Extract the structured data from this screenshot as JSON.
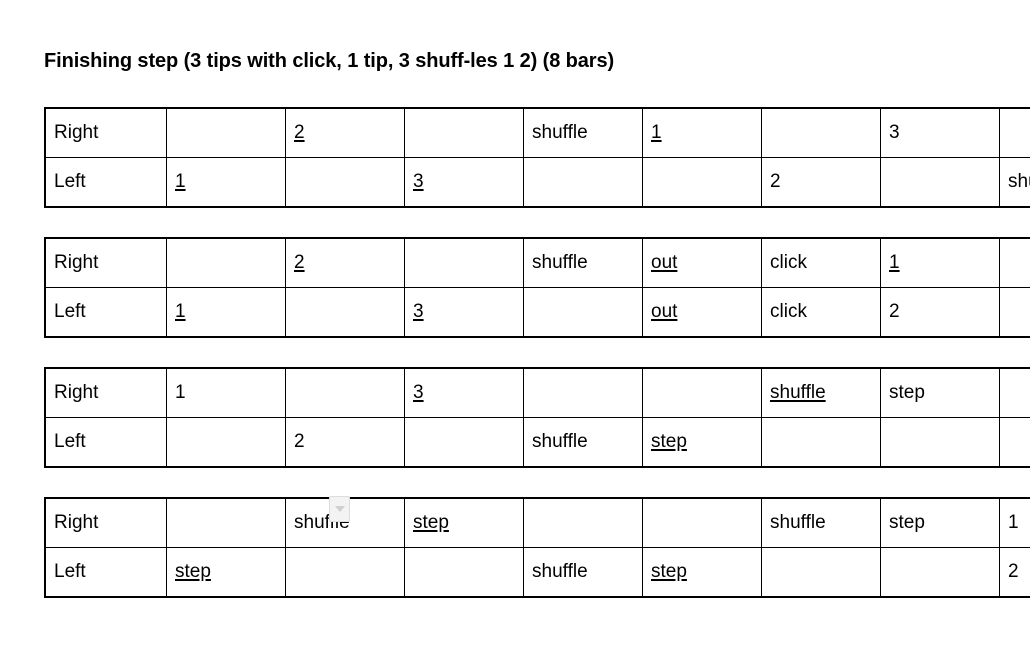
{
  "title": "Finishing step (3 tips with click, 1 tip, 3 shuff-les 1 2) (8 bars)",
  "widgets": {
    "dropdown_caret_icon": "chevron-down-icon"
  },
  "tables": [
    {
      "name": "bars-table-1",
      "rows": [
        {
          "label": "Right",
          "cells": [
            {
              "text": "",
              "underline": false,
              "align": "left"
            },
            {
              "text": "2",
              "underline": true,
              "align": "left"
            },
            {
              "text": "",
              "underline": false,
              "align": "left"
            },
            {
              "text": "shuffle",
              "underline": false,
              "align": "left"
            },
            {
              "text": "1",
              "underline": true,
              "align": "left"
            },
            {
              "text": "",
              "underline": false,
              "align": "left"
            },
            {
              "text": "3",
              "underline": false,
              "align": "left"
            },
            {
              "text": "",
              "underline": false,
              "align": "left"
            }
          ]
        },
        {
          "label": "Left",
          "cells": [
            {
              "text": "1",
              "underline": true,
              "align": "left"
            },
            {
              "text": "",
              "underline": false,
              "align": "left"
            },
            {
              "text": "3",
              "underline": true,
              "align": "left"
            },
            {
              "text": "",
              "underline": false,
              "align": "left"
            },
            {
              "text": "",
              "underline": false,
              "align": "left"
            },
            {
              "text": "2",
              "underline": false,
              "align": "left"
            },
            {
              "text": "",
              "underline": false,
              "align": "left"
            },
            {
              "text": "shuffle",
              "underline": false,
              "align": "left"
            }
          ]
        }
      ]
    },
    {
      "name": "bars-table-2",
      "rows": [
        {
          "label": "Right",
          "cells": [
            {
              "text": "",
              "underline": false,
              "align": "left"
            },
            {
              "text": "2",
              "underline": true,
              "align": "left"
            },
            {
              "text": "",
              "underline": false,
              "align": "left"
            },
            {
              "text": "shuffle",
              "underline": false,
              "align": "left"
            },
            {
              "text": "out",
              "underline": true,
              "align": "left"
            },
            {
              "text": "click",
              "underline": false,
              "align": "left"
            },
            {
              "text": "1",
              "underline": true,
              "align": "left"
            },
            {
              "text": "",
              "underline": false,
              "align": "left"
            }
          ]
        },
        {
          "label": "Left",
          "cells": [
            {
              "text": "1",
              "underline": true,
              "align": "left"
            },
            {
              "text": "",
              "underline": false,
              "align": "left"
            },
            {
              "text": "3",
              "underline": true,
              "align": "left"
            },
            {
              "text": "",
              "underline": false,
              "align": "left"
            },
            {
              "text": "out",
              "underline": true,
              "align": "left"
            },
            {
              "text": "click",
              "underline": false,
              "align": "left"
            },
            {
              "text": "2",
              "underline": false,
              "align": "right"
            },
            {
              "text": "",
              "underline": false,
              "align": "left"
            }
          ]
        }
      ]
    },
    {
      "name": "bars-table-3",
      "rows": [
        {
          "label": "Right",
          "cells": [
            {
              "text": "1",
              "underline": false,
              "align": "left"
            },
            {
              "text": "",
              "underline": false,
              "align": "left"
            },
            {
              "text": "3",
              "underline": true,
              "align": "left"
            },
            {
              "text": "",
              "underline": false,
              "align": "left"
            },
            {
              "text": "",
              "underline": false,
              "align": "left"
            },
            {
              "text": "shuffle",
              "underline": true,
              "align": "left"
            },
            {
              "text": "step",
              "underline": false,
              "align": "left"
            },
            {
              "text": "",
              "underline": false,
              "align": "left"
            }
          ]
        },
        {
          "label": "Left",
          "cells": [
            {
              "text": "",
              "underline": false,
              "align": "left"
            },
            {
              "text": "2",
              "underline": false,
              "align": "left"
            },
            {
              "text": "",
              "underline": false,
              "align": "left"
            },
            {
              "text": "shuffle",
              "underline": false,
              "align": "left"
            },
            {
              "text": "step",
              "underline": true,
              "align": "left"
            },
            {
              "text": "",
              "underline": false,
              "align": "left"
            },
            {
              "text": "",
              "underline": false,
              "align": "left"
            },
            {
              "text": "",
              "underline": false,
              "align": "left"
            }
          ]
        }
      ]
    },
    {
      "name": "bars-table-4",
      "rows": [
        {
          "label": "Right",
          "cells": [
            {
              "text": "",
              "underline": false,
              "align": "left"
            },
            {
              "text": "shuffle",
              "underline": false,
              "align": "left"
            },
            {
              "text": "step",
              "underline": true,
              "align": "left"
            },
            {
              "text": "",
              "underline": false,
              "align": "left"
            },
            {
              "text": "",
              "underline": false,
              "align": "left"
            },
            {
              "text": "shuffle",
              "underline": false,
              "align": "left"
            },
            {
              "text": "step",
              "underline": false,
              "align": "left"
            },
            {
              "text": "1",
              "underline": false,
              "align": "left"
            }
          ]
        },
        {
          "label": "Left",
          "cells": [
            {
              "text": "step",
              "underline": true,
              "align": "left"
            },
            {
              "text": "",
              "underline": false,
              "align": "left"
            },
            {
              "text": "",
              "underline": false,
              "align": "left"
            },
            {
              "text": "shuffle",
              "underline": false,
              "align": "left"
            },
            {
              "text": "step",
              "underline": true,
              "align": "left"
            },
            {
              "text": "",
              "underline": false,
              "align": "left"
            },
            {
              "text": "",
              "underline": false,
              "align": "left"
            },
            {
              "text": "2",
              "underline": false,
              "align": "right"
            }
          ]
        }
      ]
    }
  ]
}
